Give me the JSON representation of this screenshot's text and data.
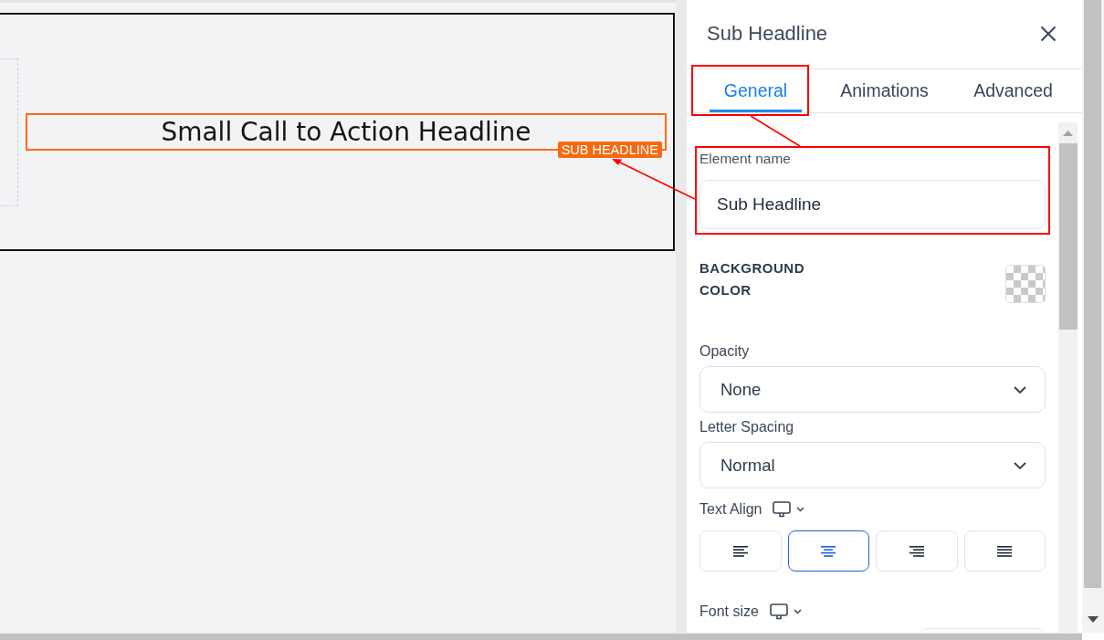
{
  "canvas": {
    "headline": "Small Call to Action Headline",
    "selection_label": "SUB HEADLINE"
  },
  "panel": {
    "title": "Sub Headline",
    "tabs": [
      {
        "label": "General",
        "selected": true
      },
      {
        "label": "Animations",
        "selected": false
      },
      {
        "label": "Advanced",
        "selected": false
      }
    ],
    "settings": [
      {
        "kind": "text",
        "label": "Element name",
        "value": "Sub Headline",
        "device_switch": false
      },
      {
        "kind": "color",
        "label": "BACKGROUND COLOR",
        "device_switch": false
      },
      {
        "kind": "select",
        "label": "Opacity",
        "value": "None",
        "device_switch": false
      },
      {
        "kind": "select",
        "label": "Letter Spacing",
        "value": "Normal",
        "device_switch": false
      },
      {
        "kind": "align",
        "label": "Text Align",
        "device_switch": true,
        "options": [
          {
            "kind": "left",
            "selected": false
          },
          {
            "kind": "center",
            "selected": true
          },
          {
            "kind": "right",
            "selected": false
          },
          {
            "kind": "justify",
            "selected": false
          }
        ]
      },
      {
        "kind": "size",
        "label": "Font size",
        "device_switch": true
      }
    ]
  }
}
